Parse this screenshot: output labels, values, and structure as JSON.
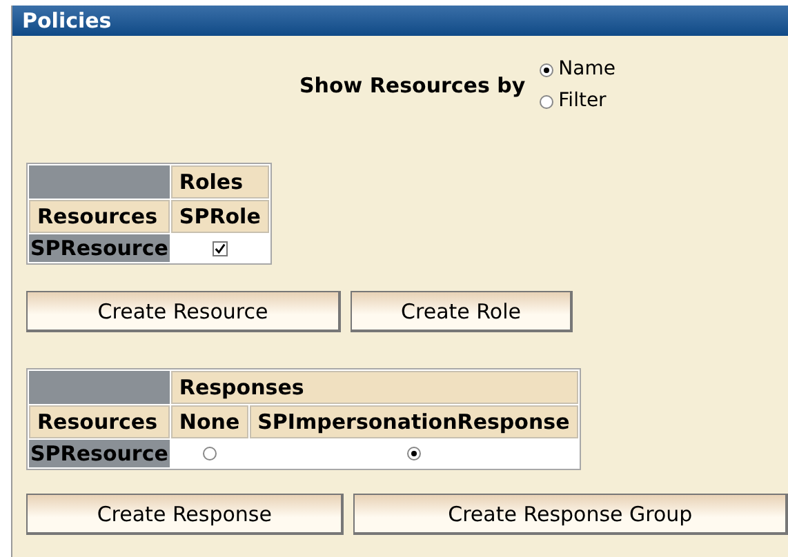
{
  "title": "Policies",
  "show_by": {
    "label": "Show Resources by",
    "options": [
      {
        "label": "Name",
        "selected": true
      },
      {
        "label": "Filter",
        "selected": false
      }
    ]
  },
  "roles_table": {
    "group_header": "Roles",
    "row_header": "Resources",
    "columns": [
      "SPRole"
    ],
    "rows": [
      {
        "name": "SPResource",
        "cells": [
          {
            "checked": true
          }
        ]
      }
    ]
  },
  "buttons_1": [
    "Create Resource",
    "Create Role"
  ],
  "responses_table": {
    "group_header": "Responses",
    "row_header": "Resources",
    "columns": [
      "None",
      "SPImpersonationResponse"
    ],
    "rows": [
      {
        "name": "SPResource",
        "cells": [
          {
            "selected": false
          },
          {
            "selected": true
          }
        ]
      }
    ]
  },
  "buttons_2": [
    "Create Response",
    "Create Response Group"
  ]
}
